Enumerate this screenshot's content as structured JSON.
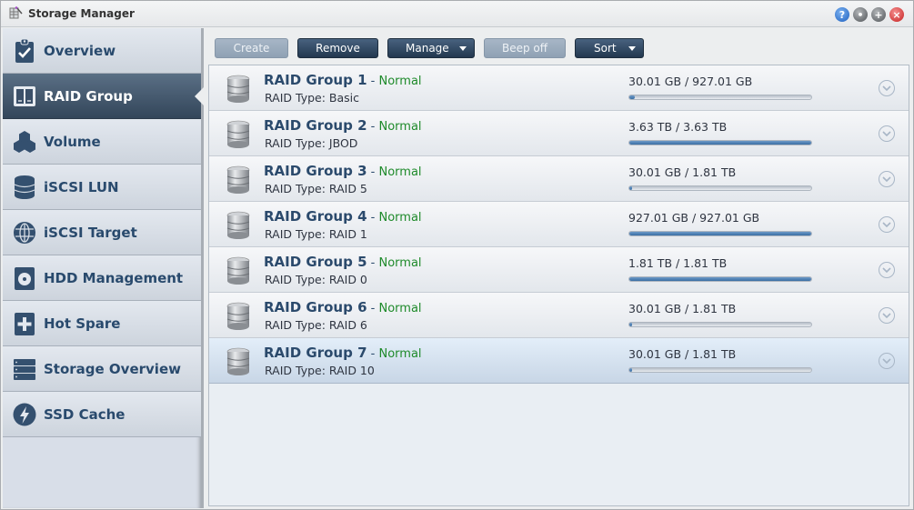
{
  "window": {
    "title": "Storage Manager",
    "controls": [
      {
        "name": "help-icon",
        "glyph": "?"
      },
      {
        "name": "minimize-icon",
        "glyph": "•"
      },
      {
        "name": "maximize-icon",
        "glyph": "+"
      },
      {
        "name": "close-icon",
        "glyph": "×"
      }
    ]
  },
  "sidebar": {
    "active_index": 1,
    "items": [
      {
        "label": "Overview",
        "icon": "clipboard-check-icon"
      },
      {
        "label": "RAID Group",
        "icon": "raid-group-icon"
      },
      {
        "label": "Volume",
        "icon": "hexagons-icon"
      },
      {
        "label": "iSCSI LUN",
        "icon": "database-icon"
      },
      {
        "label": "iSCSI Target",
        "icon": "globe-icon"
      },
      {
        "label": "HDD Management",
        "icon": "hard-disk-icon"
      },
      {
        "label": "Hot Spare",
        "icon": "plus-disk-icon"
      },
      {
        "label": "Storage Overview",
        "icon": "server-rack-icon"
      },
      {
        "label": "SSD Cache",
        "icon": "lightning-icon"
      }
    ]
  },
  "toolbar": {
    "create": "Create",
    "remove": "Remove",
    "manage": "Manage",
    "beep_off": "Beep off",
    "sort": "Sort"
  },
  "raid_groups": [
    {
      "name": "RAID Group 1",
      "separator": " - ",
      "status": "Normal",
      "type": "RAID Type: Basic",
      "usage": "30.01 GB / 927.01 GB",
      "used_fraction": 0.032
    },
    {
      "name": "RAID Group 2",
      "separator": " - ",
      "status": "Normal",
      "type": "RAID Type: JBOD",
      "usage": "3.63 TB / 3.63 TB",
      "used_fraction": 1.0
    },
    {
      "name": "RAID Group 3",
      "separator": " - ",
      "status": "Normal",
      "type": "RAID Type: RAID 5",
      "usage": "30.01 GB / 1.81 TB",
      "used_fraction": 0.016
    },
    {
      "name": "RAID Group 4",
      "separator": " - ",
      "status": "Normal",
      "type": "RAID Type: RAID 1",
      "usage": "927.01 GB / 927.01 GB",
      "used_fraction": 1.0
    },
    {
      "name": "RAID Group 5",
      "separator": " - ",
      "status": "Normal",
      "type": "RAID Type: RAID 0",
      "usage": "1.81 TB / 1.81 TB",
      "used_fraction": 1.0
    },
    {
      "name": "RAID Group 6",
      "separator": " - ",
      "status": "Normal",
      "type": "RAID Type: RAID 6",
      "usage": "30.01 GB / 1.81 TB",
      "used_fraction": 0.016
    },
    {
      "name": "RAID Group 7",
      "separator": " - ",
      "status": "Normal",
      "type": "RAID Type: RAID 10",
      "usage": "30.01 GB / 1.81 TB",
      "used_fraction": 0.016
    }
  ],
  "selected_row": 6,
  "colors": {
    "status_normal": "#1e8a2a",
    "accent_dark": "#23384f",
    "progress_fill": "#3a6ea4"
  }
}
